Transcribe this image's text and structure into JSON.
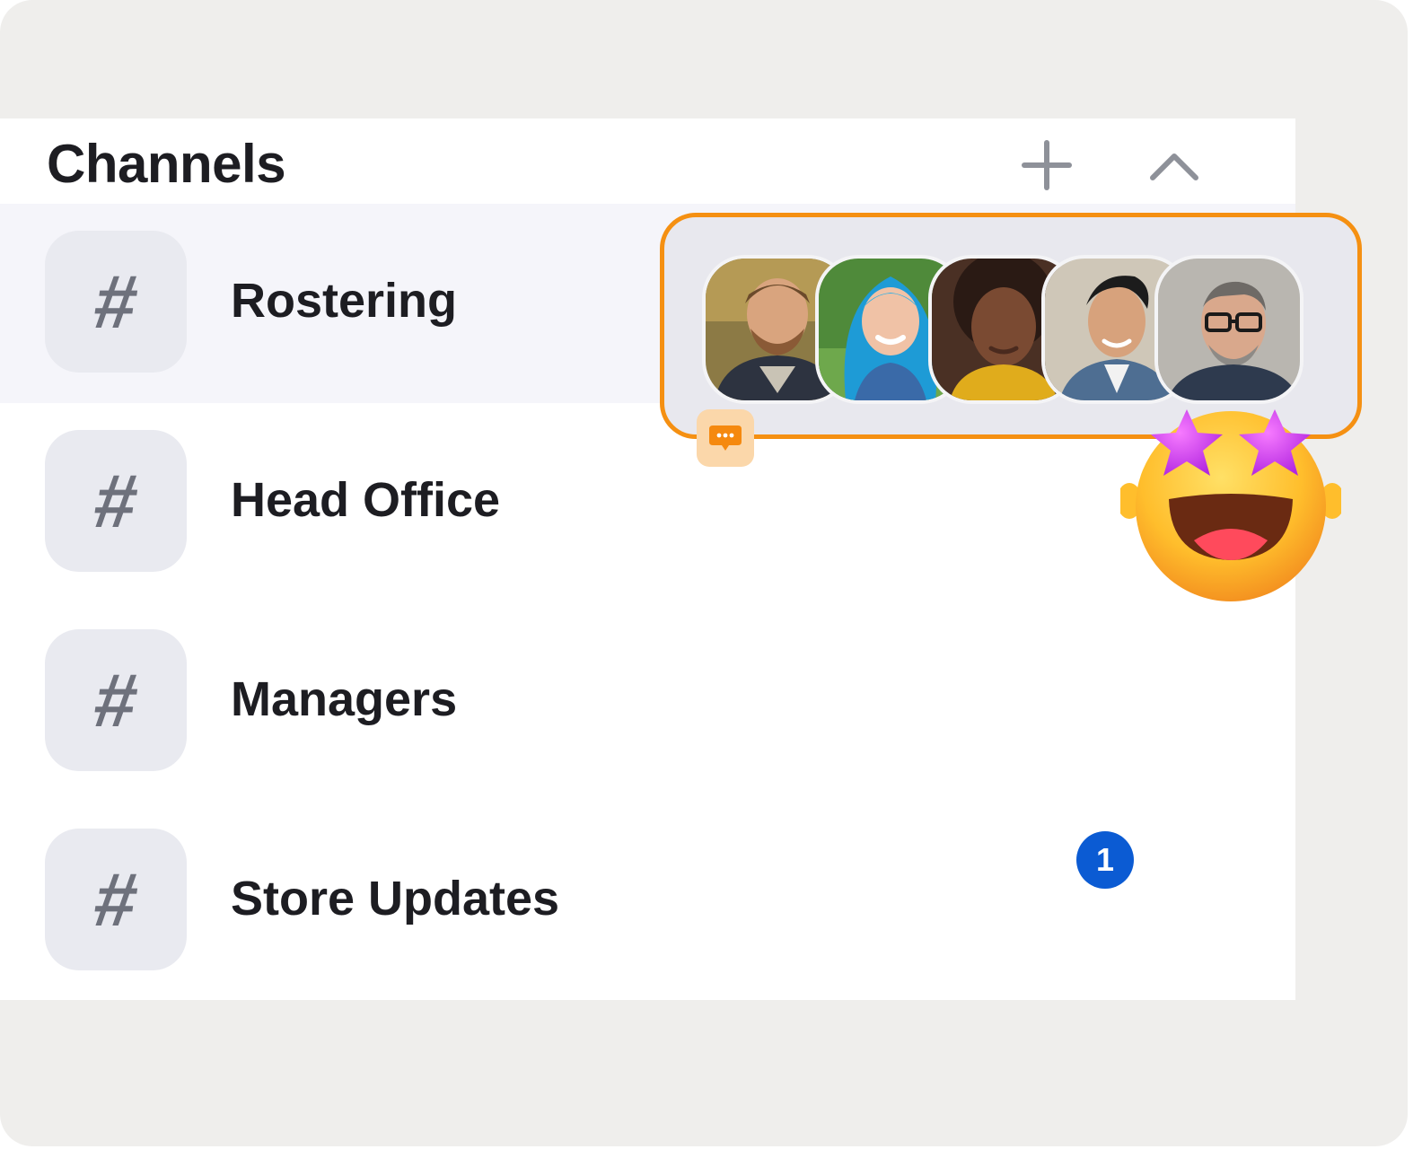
{
  "panel": {
    "title": "Channels",
    "add_icon": "plus-icon",
    "collapse_icon": "chevron-up-icon"
  },
  "channels": [
    {
      "name": "Rostering",
      "icon": "hash-icon",
      "active": true,
      "unread": null
    },
    {
      "name": "Head Office",
      "icon": "hash-icon",
      "active": false,
      "unread": null
    },
    {
      "name": "Managers",
      "icon": "hash-icon",
      "active": false,
      "unread": null
    },
    {
      "name": "Store Updates",
      "icon": "hash-icon",
      "active": false,
      "unread": "1"
    }
  ],
  "presence": {
    "avatar_count": 5,
    "accent": "#f59012",
    "reaction_icon": "star-struck-emoji-icon",
    "chat_icon": "chat-bubble-icon"
  },
  "hash_glyph": "#",
  "colors": {
    "accent": "#f59012",
    "badge": "#0b5bd3",
    "text": "#1d1d22",
    "tile": "#e9eaf0",
    "frame": "#efeeec"
  }
}
